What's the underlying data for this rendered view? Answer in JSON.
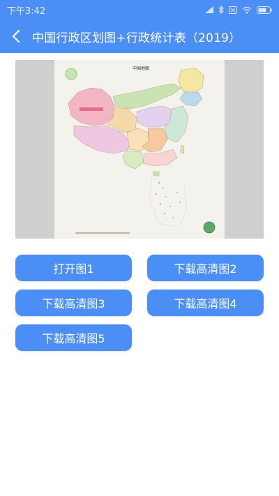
{
  "status_bar": {
    "time": "下午3:42",
    "icons": [
      "signal-icon",
      "bluetooth-icon",
      "sim-icon",
      "wifi-icon",
      "battery-icon"
    ]
  },
  "app_bar": {
    "back_icon": "chevron-left-icon",
    "title": "中国行政区划图+行政统计表（2019）"
  },
  "map_image": {
    "title": "中国地图"
  },
  "buttons": {
    "open_1": "打开图1",
    "download_2": "下载高清图2",
    "download_3": "下载高清图3",
    "download_4": "下载高清图4",
    "download_5": "下载高清图5"
  },
  "colors": {
    "primary": "#4b8ef5",
    "frame_gray": "#cfcfcf",
    "background": "#ffffff"
  }
}
